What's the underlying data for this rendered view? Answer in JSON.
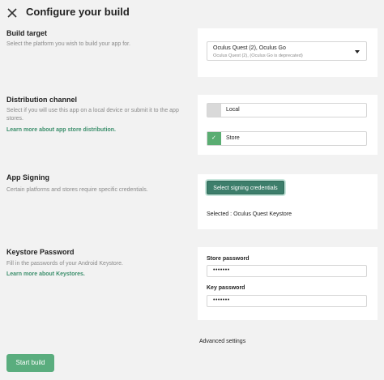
{
  "header": {
    "title": "Configure your build",
    "close_icon": "close-icon"
  },
  "build_target": {
    "title": "Build target",
    "description": "Select the platform you wish to build your app for.",
    "select": {
      "value": "Oculus Quest (2), Oculus Go",
      "subtext": "Oculus Quest (2), (Oculus Go is deprecated)",
      "icon": "chevron-down-icon"
    }
  },
  "distribution": {
    "title": "Distribution channel",
    "description": "Select if you will use this app on a local device or submit it to the app stores.",
    "link": "Learn more about app store distribution.",
    "options": [
      {
        "label": "Local",
        "checked": false
      },
      {
        "label": "Store",
        "checked": true
      }
    ],
    "check_glyph": "✓"
  },
  "signing": {
    "title": "App Signing",
    "description": "Certain platforms and stores require specific credentials.",
    "button": "Select signing credentials",
    "selected": "Selected : Oculus Quest Keystore"
  },
  "keystore": {
    "title": "Keystore Password",
    "description": "Fill in the passwords of your Android Keystore.",
    "link": "Learn more about Keystores.",
    "store_label": "Store password",
    "store_value": "•••••••",
    "key_label": "Key password",
    "key_value": "•••••••"
  },
  "advanced": "Advanced settings",
  "start_button": "Start build",
  "colors": {
    "accent": "#3d7e6b",
    "check": "#5aad72",
    "link": "#3c8f6c",
    "start": "#5aad7e"
  }
}
